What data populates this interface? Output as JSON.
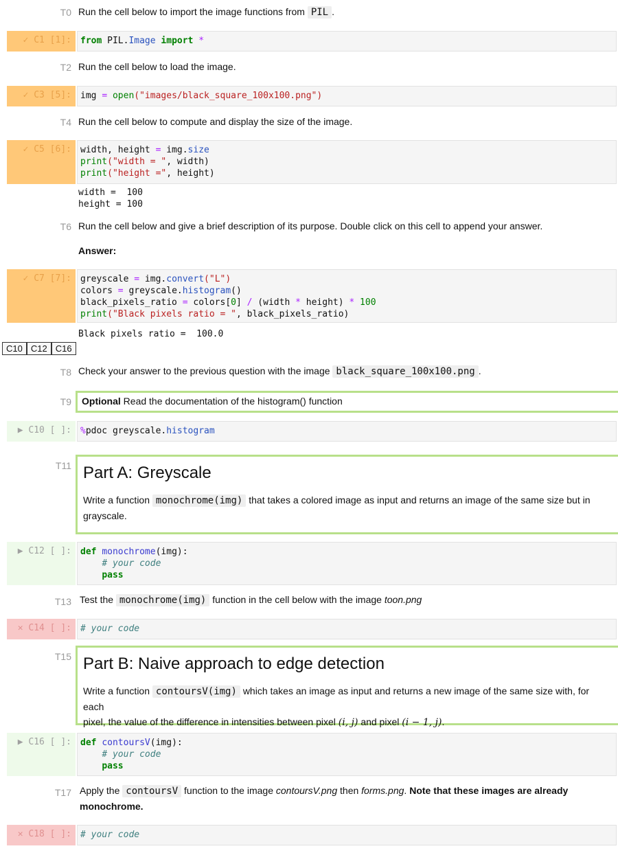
{
  "cells": {
    "t0": {
      "label": "T0",
      "text": "Run the cell below to import the image functions from",
      "code": "PIL",
      "tail": "."
    },
    "c1": {
      "prompt": "✓ C1 [1]:",
      "code": {
        "k1": "from",
        "mod": "PIL.",
        "mod2": "Image",
        "k2": "import",
        "star": "*"
      }
    },
    "t2": {
      "label": "T2",
      "text": "Run the cell below to load the image."
    },
    "c3": {
      "prompt": "✓ C3 [5]:",
      "code": {
        "var": "img",
        "eq": "=",
        "fn": "open",
        "arg": "(\"images/black_square_100x100.png\")"
      }
    },
    "t4": {
      "label": "T4",
      "text": "Run the cell below to compute and display the size of the image."
    },
    "c5": {
      "prompt": "✓ C5 [6]:",
      "lines": [
        "width, height ",
        "= ",
        "img.",
        "size",
        "print",
        "(\"width = \"",
        ", width)",
        "print",
        "(\"height =\"",
        ", height)"
      ],
      "output": "width =  100\nheight = 100"
    },
    "t6": {
      "label": "T6",
      "text": "Run the cell below and give a brief description of its purpose. Double click on this cell to append your answer.",
      "answer": "Answer:"
    },
    "c7": {
      "prompt": "✓ C7 [7]:",
      "output": "Black pixels ratio =  100.0"
    },
    "tabs": [
      "C10",
      "C12",
      "C16"
    ],
    "t8": {
      "label": "T8",
      "text": "Check your answer to the previous question with the image",
      "code": "black_square_100x100.png",
      "tail": "."
    },
    "t9": {
      "label": "T9",
      "bold": "Optional",
      "text": "Read the documentation of the histogram() function"
    },
    "c10": {
      "prompt": "▶ C10 [ ]:",
      "magic": "%",
      "code": "pdoc greyscale.",
      "attr": "histogram"
    },
    "t11": {
      "label": "T11",
      "title": "Part A: Greyscale",
      "pre": "Write a function",
      "code": "monochrome(img)",
      "post": "that takes a colored image as input and returns an image of the same size but in",
      "post2": "grayscale."
    },
    "c12": {
      "prompt": "▶ C12 [ ]:",
      "def": "def",
      "fname": "monochrome",
      "args": "(img):",
      "comment": "# your code",
      "pass": "pass"
    },
    "t13": {
      "label": "T13",
      "pre": "Test the",
      "code": "monochrome(img)",
      "post": "function in the cell below with the image",
      "italic": "toon.png"
    },
    "c14": {
      "prompt": "✕ C14 [ ]:",
      "comment": "# your code"
    },
    "t15": {
      "label": "T15",
      "title": "Part B: Naive approach to edge detection",
      "pre": "Write a function",
      "code": "contoursV(img)",
      "post": "which takes an image as input and returns a new image of the same size with, for each",
      "line2a": "pixel, the value of the difference in intensities between pixel",
      "m1": "(i, j)",
      "and": "and pixel",
      "m2": "(i − 1, j)",
      "dot": "."
    },
    "c16": {
      "prompt": "▶ C16 [ ]:",
      "def": "def",
      "fname": "contoursV",
      "args": "(img):",
      "comment": "# your code",
      "pass": "pass"
    },
    "t17": {
      "label": "T17",
      "pre": "Apply the",
      "code": "contoursV",
      "post": "function to the image",
      "i1": "contoursV.png",
      "then": "then",
      "i2": "forms.png",
      "dot": ".",
      "bold": "Note that these images are already",
      "bold2": "monochrome."
    },
    "c18": {
      "prompt": "✕ C18 [ ]:",
      "comment": "# your code"
    }
  },
  "colors": {
    "executed": "#ffc878",
    "pending": "#eefaea",
    "error": "#f8c8c8",
    "markdown_border": "#b8e08a"
  }
}
